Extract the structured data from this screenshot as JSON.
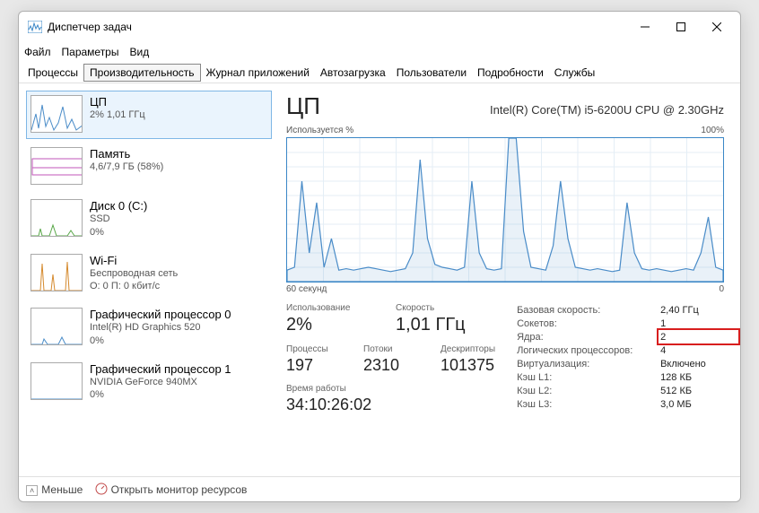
{
  "window": {
    "title": "Диспетчер задач"
  },
  "menu": {
    "file": "Файл",
    "options": "Параметры",
    "view": "Вид"
  },
  "tabs": {
    "processes": "Процессы",
    "performance": "Производительность",
    "app_history": "Журнал приложений",
    "startup": "Автозагрузка",
    "users": "Пользователи",
    "details": "Подробности",
    "services": "Службы"
  },
  "sidebar": [
    {
      "title": "ЦП",
      "sub1": "2%  1,01 ГГц",
      "sub2": "",
      "color": "#4a8cc8"
    },
    {
      "title": "Память",
      "sub1": "4,6/7,9 ГБ (58%)",
      "sub2": "",
      "color": "#c256b8"
    },
    {
      "title": "Диск 0 (C:)",
      "sub1": "SSD",
      "sub2": "0%",
      "color": "#5aa84a"
    },
    {
      "title": "Wi-Fi",
      "sub1": "Беспроводная сеть",
      "sub2": "О: 0  П: 0 кбит/с",
      "color": "#d58a2e"
    },
    {
      "title": "Графический процессор 0",
      "sub1": "Intel(R) HD Graphics 520",
      "sub2": "0%",
      "color": "#4a8cc8"
    },
    {
      "title": "Графический процессор 1",
      "sub1": "NVIDIA GeForce 940MX",
      "sub2": "0%",
      "color": "#4a8cc8"
    }
  ],
  "main": {
    "title": "ЦП",
    "subtitle": "Intel(R) Core(TM) i5-6200U CPU @ 2.30GHz",
    "chart_top_left": "Используется %",
    "chart_top_right": "100%",
    "chart_bottom_left": "60 секунд",
    "chart_bottom_right": "0",
    "stats_left": {
      "usage_label": "Использование",
      "usage_value": "2%",
      "speed_label": "Скорость",
      "speed_value": "1,01 ГГц",
      "procs_label": "Процессы",
      "procs_value": "197",
      "threads_label": "Потоки",
      "threads_value": "2310",
      "handles_label": "Дескрипторы",
      "handles_value": "101375",
      "uptime_label": "Время работы",
      "uptime_value": "34:10:26:02"
    },
    "stats_right": {
      "base_speed_label": "Базовая скорость:",
      "base_speed_value": "2,40 ГГц",
      "sockets_label": "Сокетов:",
      "sockets_value": "1",
      "cores_label": "Ядра:",
      "cores_value": "2",
      "lprocs_label": "Логических процессоров:",
      "lprocs_value": "4",
      "virt_label": "Виртуализация:",
      "virt_value": "Включено",
      "l1_label": "Кэш L1:",
      "l1_value": "128 КБ",
      "l2_label": "Кэш L2:",
      "l2_value": "512 КБ",
      "l3_label": "Кэш L3:",
      "l3_value": "3,0 МБ"
    }
  },
  "footer": {
    "less": "Меньше",
    "resmon": "Открыть монитор ресурсов"
  },
  "chart_data": {
    "type": "area",
    "title": "Используется %",
    "xlabel": "60 секунд",
    "ylabel": "",
    "ylim": [
      0,
      100
    ],
    "xlim": [
      60,
      0
    ],
    "series": [
      {
        "name": "CPU",
        "values": [
          8,
          10,
          70,
          20,
          55,
          10,
          30,
          8,
          9,
          8,
          9,
          10,
          9,
          8,
          7,
          8,
          9,
          20,
          85,
          30,
          12,
          10,
          9,
          8,
          10,
          70,
          20,
          9,
          8,
          9,
          100,
          100,
          35,
          10,
          9,
          8,
          25,
          70,
          30,
          10,
          9,
          8,
          9,
          8,
          7,
          8,
          55,
          20,
          9,
          8,
          9,
          8,
          7,
          8,
          9,
          8,
          20,
          45,
          10,
          8
        ]
      }
    ]
  }
}
